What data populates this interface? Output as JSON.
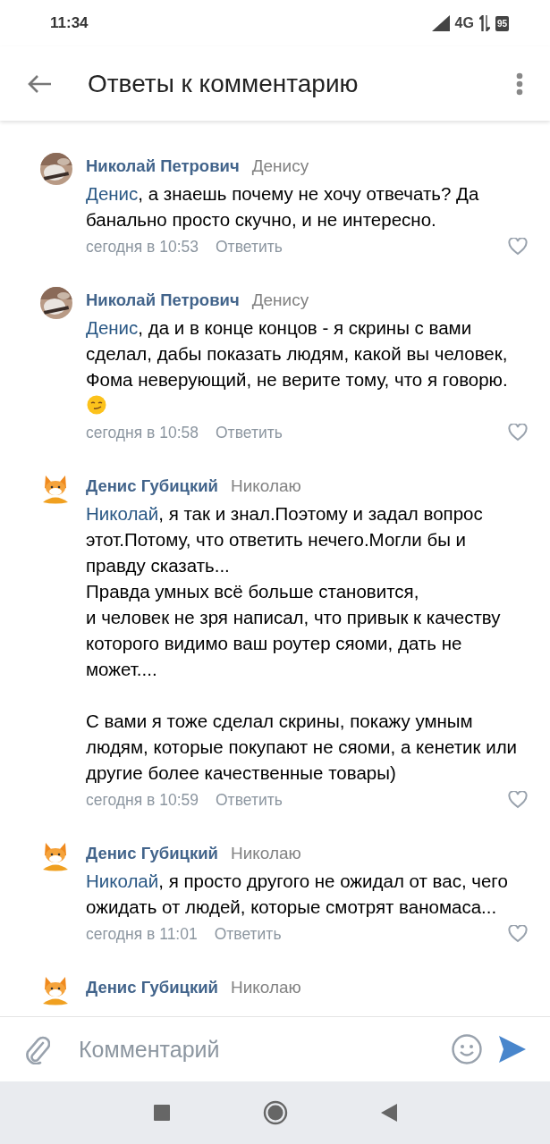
{
  "status_bar": {
    "time": "11:34",
    "network": "4G",
    "battery": "95"
  },
  "header": {
    "title": "Ответы к комментарию"
  },
  "comments": [
    {
      "author": "Николай Петрович",
      "reply_to": "Денису",
      "mention": "Денис",
      "text": ", а знаешь почему не хочу отвечать? Да банально просто скучно, и не интересно.",
      "emoji": false,
      "date": "сегодня в 10:53",
      "reply": "Ответить",
      "liked": false
    },
    {
      "author": "Николай Петрович",
      "reply_to": "Денису",
      "mention": "Денис",
      "text": ", да и в конце концов - я скрины с вами сделал, дабы показать людям, какой вы человек, Фома неверующий, не верите тому, что я говорю.",
      "emoji": true,
      "date": "сегодня в 10:58",
      "reply": "Ответить",
      "liked": false
    },
    {
      "kind": "fox",
      "author": "Денис Губицкий",
      "reply_to": "Николаю",
      "mention": "Николай",
      "text": ", я так и знал.Поэтому и задал вопрос этот.Потому, что ответить нечего.Могли бы и правду сказать...\nПравда умных всё больше становится,\nи человек не зря написал, что привык к качеству которого видимо ваш роутер сяоми, дать не может....\n\nС вами я тоже сделал скрины, покажу умным людям, которые покупают не сяоми, а кенетик или другие более качественные товары)",
      "emoji": false,
      "date": "сегодня в 10:59",
      "reply": "Ответить",
      "liked": false
    },
    {
      "kind": "fox",
      "author": "Денис Губицкий",
      "reply_to": "Николаю",
      "mention": "Николай",
      "text": ", я просто другого не ожидал от вас, чего ожидать от людей, которые смотрят ваномаса...",
      "emoji": false,
      "date": "сегодня в 11:01",
      "reply": "Ответить",
      "liked": false
    },
    {
      "kind": "fox",
      "author": "Денис Губицкий",
      "reply_to": "Николаю"
    }
  ],
  "composer": {
    "placeholder": "Комментарий"
  }
}
